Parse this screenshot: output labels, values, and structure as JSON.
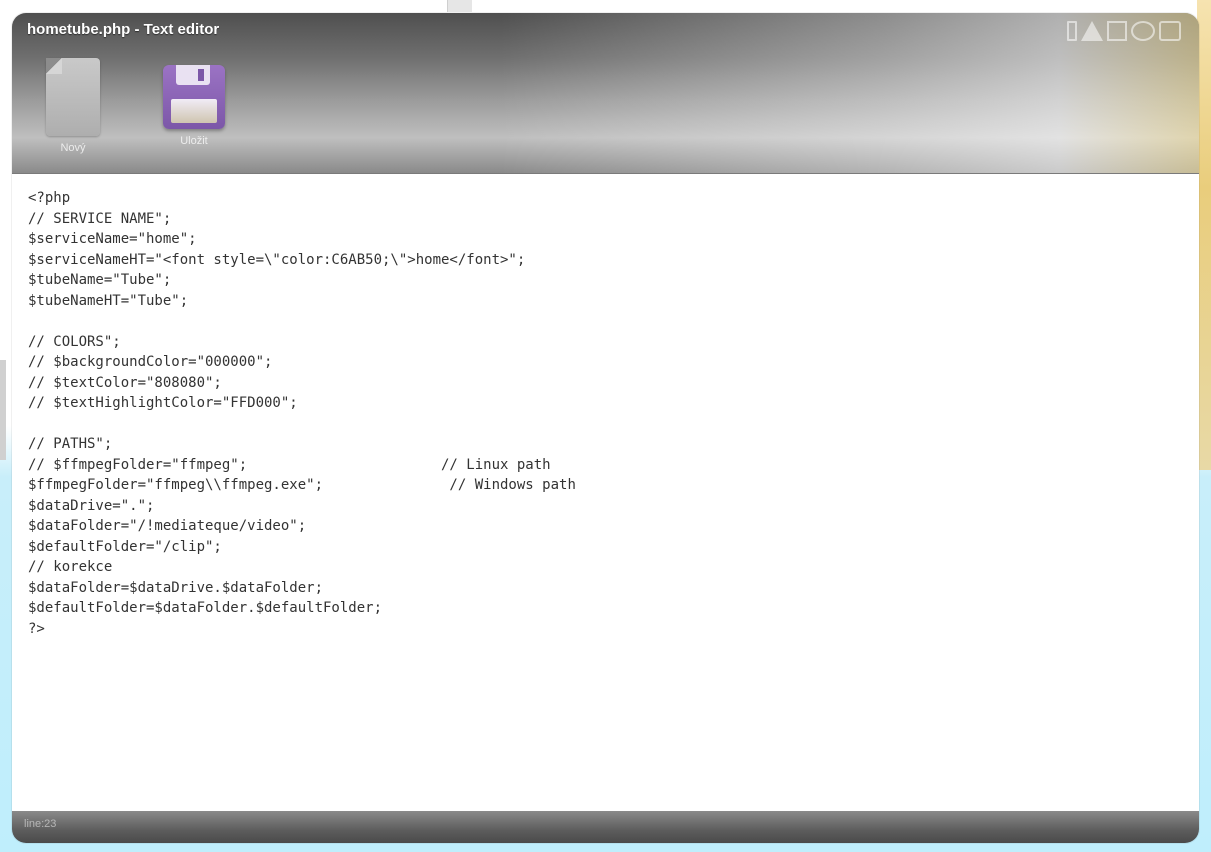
{
  "window": {
    "title": "hometube.php - Text editor"
  },
  "toolbar": {
    "new_label": "Nový",
    "save_label": "Uložit",
    "new_icon": "document-icon",
    "save_icon": "floppy-disk-icon",
    "save_color": "#8a63b6"
  },
  "editor": {
    "lines": [
      "<?php",
      "// SERVICE NAME\";",
      "$serviceName=\"home\";",
      "$serviceNameHT=\"<font style=\\\"color:C6AB50;\\\">home</font>\";",
      "$tubeName=\"Tube\";",
      "$tubeNameHT=\"Tube\";",
      "",
      "// COLORS\";",
      "// $backgroundColor=\"000000\";",
      "// $textColor=\"808080\";",
      "// $textHighlightColor=\"FFD000\";",
      "",
      "// PATHS\";",
      "// $ffmpegFolder=\"ffmpeg\";                       // Linux path",
      "$ffmpegFolder=\"ffmpeg\\\\ffmpeg.exe\";               // Windows path",
      "$dataDrive=\".\";",
      "$dataFolder=\"/!mediateque/video\";",
      "$defaultFolder=\"/clip\";",
      "// korekce",
      "$dataFolder=$dataDrive.$dataFolder;",
      "$defaultFolder=$dataFolder.$defaultFolder;",
      "?>"
    ]
  },
  "statusbar": {
    "text": "line:23"
  }
}
